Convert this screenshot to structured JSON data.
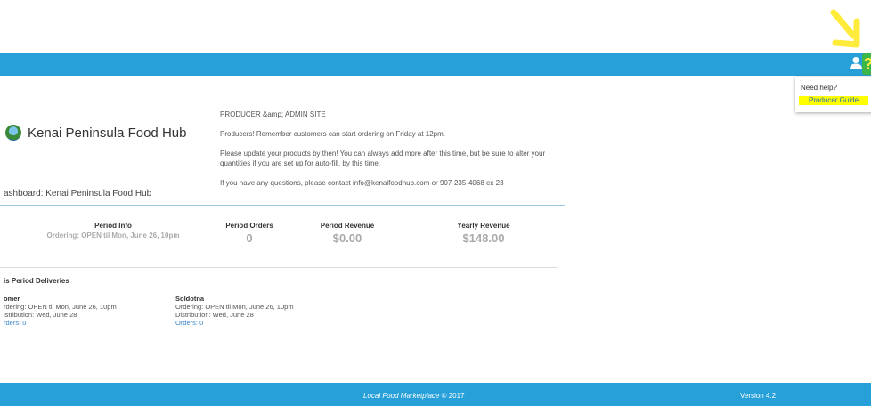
{
  "header": {
    "user_icon": "user-icon",
    "help_icon": "help-icon",
    "help_glyph": "?",
    "accent": "#27a0da",
    "annotation_color": "#ffeb3b"
  },
  "help_panel": {
    "title": "Need help?",
    "link": "Producer Guide"
  },
  "brand": {
    "name": "Kenai Peninsula Food Hub"
  },
  "notice": {
    "line1": "PRODUCER &amp; ADMIN SITE",
    "line2": "Producers! Remember customers can start ordering on Friday at 12pm.",
    "line3a": "Please update your products by then! You can always add more after this time, but be sure to alter your",
    "line3b": "quantities if you are set up for auto-fill, by this time.",
    "line4": "If you have any questions, please contact info@kenaifoodhub.com or 907-235-4068 ex 23"
  },
  "dashboard": {
    "title": "ashboard: Kenai Peninsula Food Hub",
    "stats": [
      {
        "label": "Period Info",
        "value": "Ordering: OPEN til Mon, June 26, 10pm"
      },
      {
        "label": "Period Orders",
        "value": "0"
      },
      {
        "label": "Period Revenue",
        "value": "$0.00"
      },
      {
        "label": "Yearly Revenue",
        "value": "$148.00"
      }
    ]
  },
  "deliveries": {
    "title": "is Period Deliveries",
    "items": [
      {
        "name": "omer",
        "ordering": "rdering: OPEN til Mon, June 26, 10pm",
        "distribution": "istribution: Wed, June 28",
        "orders": "rders: 0"
      },
      {
        "name": "Soldotna",
        "ordering": "Ordering: OPEN til Mon, June 26, 10pm",
        "distribution": "Distribution: Wed, June 28",
        "orders": "Orders: 0"
      }
    ]
  },
  "footer": {
    "product": "Local Food Marketplace",
    "copyright": " © 2017",
    "version": "Version 4.2"
  }
}
